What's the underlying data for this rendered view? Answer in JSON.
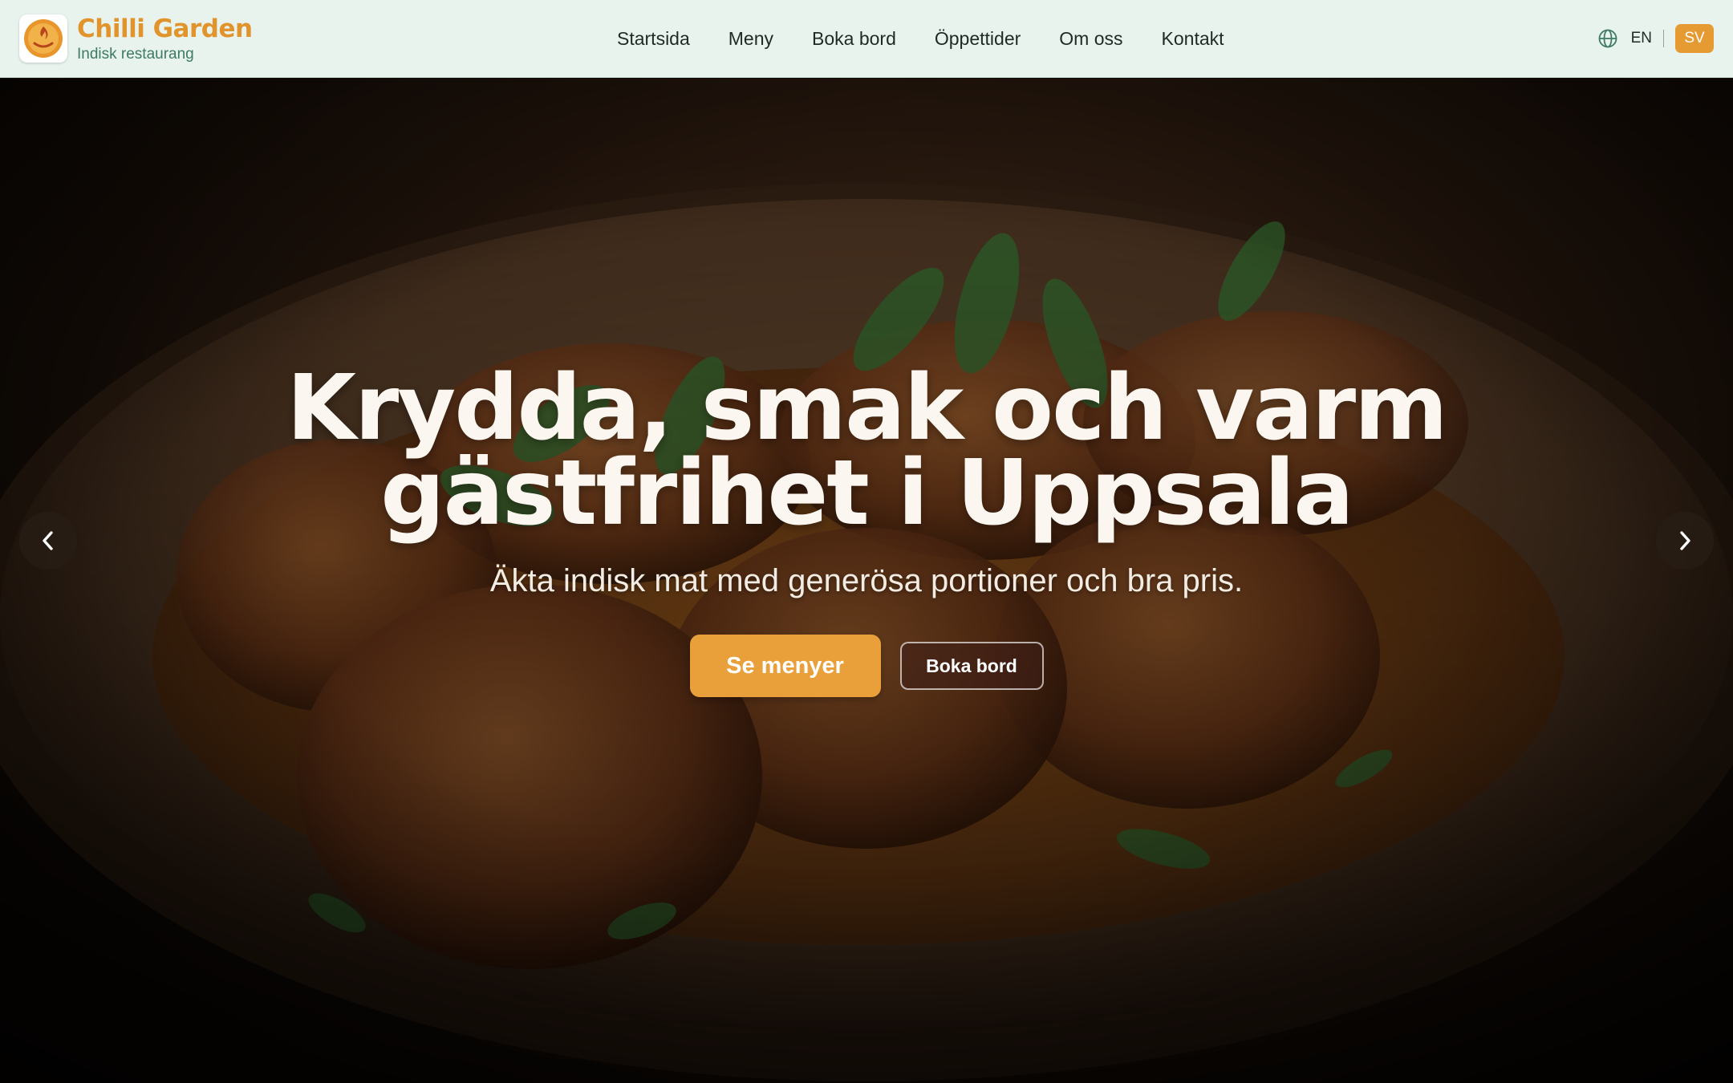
{
  "brand": {
    "name": "Chilli Garden",
    "tagline": "Indisk restaurang",
    "accent_color": "#e1942c",
    "tagline_color": "#3f7a63"
  },
  "nav": {
    "items": [
      {
        "label": "Startsida"
      },
      {
        "label": "Meny"
      },
      {
        "label": "Boka bord"
      },
      {
        "label": "Öppettider"
      },
      {
        "label": "Om oss"
      },
      {
        "label": "Kontakt"
      }
    ]
  },
  "language": {
    "icon": "globe-icon",
    "options": [
      "EN",
      "SV"
    ],
    "selected": "SV",
    "selected_color": "#e69a32"
  },
  "hero": {
    "title_line1": "Krydda, smak och varm",
    "title_line2": "gästfrihet i Uppsala",
    "subtitle": "Äkta indisk mat med generösa portioner och bra pris.",
    "primary_button": "Se menyer",
    "secondary_button": "Boka bord",
    "primary_color": "#e9a03b",
    "prev_icon": "chevron-left-icon",
    "next_icon": "chevron-right-icon"
  }
}
